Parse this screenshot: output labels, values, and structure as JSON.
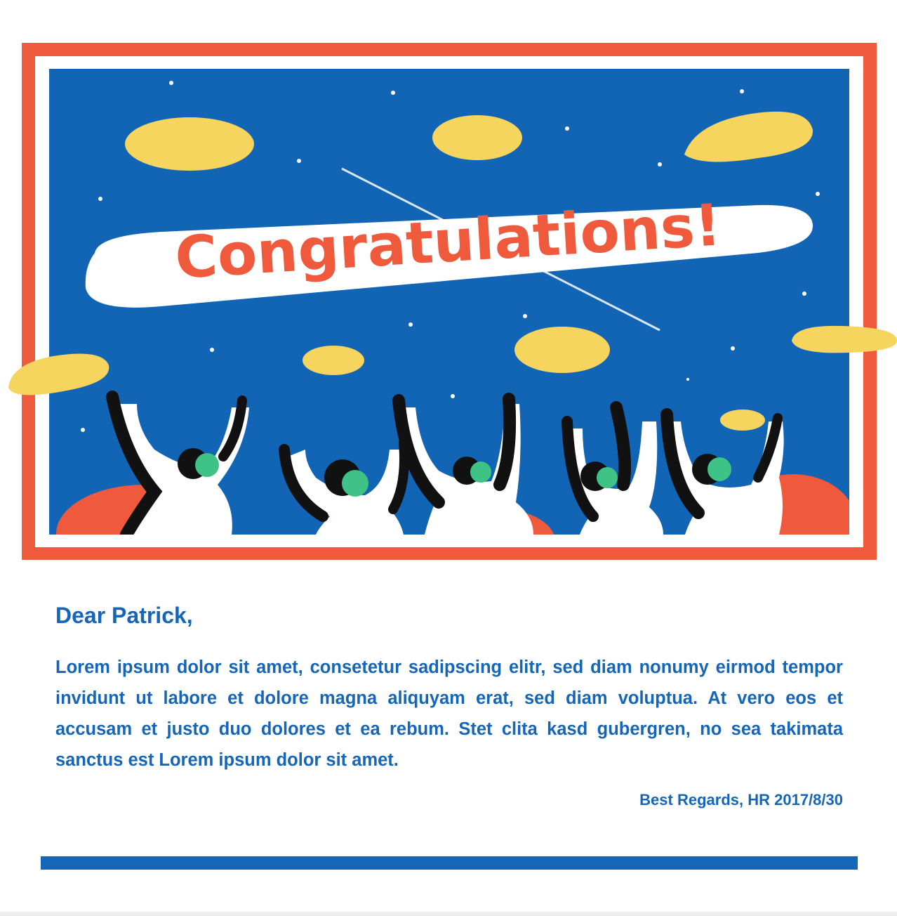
{
  "banner": {
    "headline": "Congratulations!",
    "colors": {
      "frame": "#ef5a3c",
      "sky": "#1265b5",
      "blob": "#f6d55f",
      "face": "#3fc285",
      "ink": "#111111"
    }
  },
  "letter": {
    "greeting": "Dear Patrick,",
    "body": "Lorem ipsum dolor sit amet, consetetur sadipscing elitr, sed diam nonumy eirmod tempor invidunt ut labore et dolore magna aliquyam erat, sed diam voluptua. At vero eos et accusam et justo duo dolores et ea rebum. Stet clita kasd gubergren, no sea takimata sanctus est Lorem ipsum dolor sit amet.",
    "signature": "Best Regards, HR 2017/8/30"
  },
  "colors": {
    "text": "#1565b8",
    "footer_bar": "#1565b8"
  }
}
